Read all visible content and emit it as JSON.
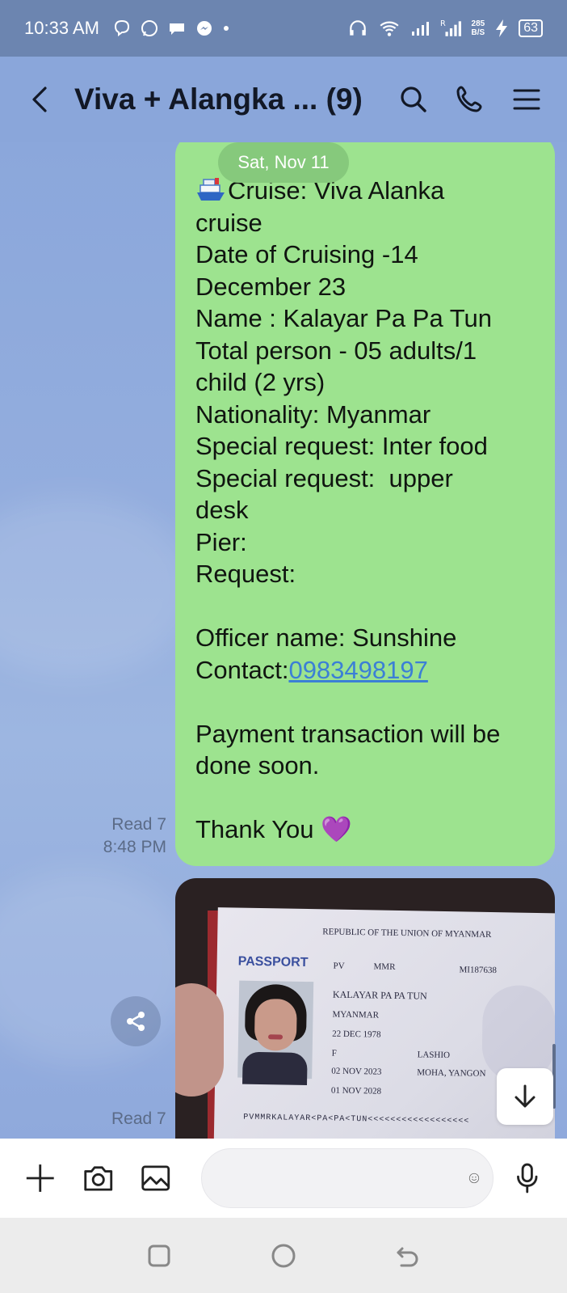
{
  "status_bar": {
    "time": "10:33 AM",
    "net_speed_value": "285",
    "net_speed_unit": "B/S",
    "battery": "63"
  },
  "header": {
    "title": "Viva + Alangka ... (9)",
    "icons": [
      "back-icon",
      "search-icon",
      "phone-icon",
      "menu-icon"
    ]
  },
  "chat": {
    "date_pill": "Sat, Nov 11",
    "message": {
      "lines": [
        "Cruise: Viva Alanka",
        "cruise",
        "Date of Cruising -14",
        "December 23",
        "Name : Kalayar Pa Pa Tun",
        "Total person - 05 adults/1",
        "child (2 yrs)",
        "Nationality: Myanmar",
        "Special request: Inter food",
        "Special request:  upper",
        "desk",
        "Pier:",
        "Request:",
        "",
        "Officer name: Sunshine"
      ],
      "contact_label": "Contact:",
      "contact_number": "0983498197",
      "lines_after": [
        "",
        "Payment transaction will be",
        "done soon.",
        ""
      ],
      "closing": "Thank You",
      "closing_emoji": "💜",
      "read_status": "Read 7",
      "time": "8:48 PM"
    },
    "photo_message": {
      "passport": {
        "header": "REPUBLIC OF THE UNION OF MYANMAR",
        "word": "PASSPORT",
        "type": "PV",
        "country_code": "MMR",
        "passport_no": "MI187638",
        "name": "KALAYAR PA PA TUN",
        "nationality": "MYANMAR",
        "dob": "22 DEC 1978",
        "sex": "F",
        "place_of_birth": "LASHIO",
        "issue_date": "02 NOV 2023",
        "authority": "MOHA, YANGON",
        "expiry_date": "01 NOV 2028",
        "mrz": "PVMMRKALAYAR<PA<PA<TUN<<<<<<<<<<<<<<<<<<"
      },
      "read_status": "Read 7"
    }
  },
  "input_bar": {
    "placeholder": "",
    "icons": [
      "plus-icon",
      "camera-icon",
      "image-icon",
      "emoji-icon",
      "mic-icon"
    ]
  },
  "colors": {
    "chat_bg": "#8aa6da",
    "bubble": "#9de38f",
    "link": "#3b7fd6"
  }
}
